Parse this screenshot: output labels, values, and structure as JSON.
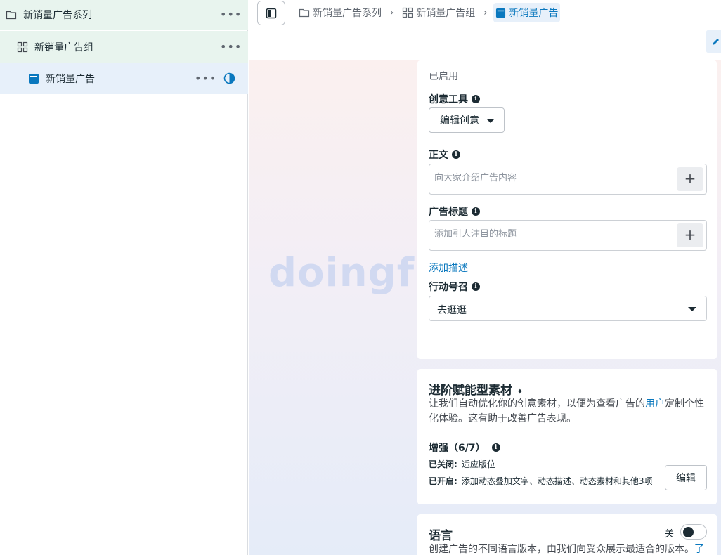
{
  "sidebar": {
    "items": [
      {
        "label": "新销量广告系列",
        "icon": "folder-icon"
      },
      {
        "label": "新销量广告组",
        "icon": "grid-icon"
      },
      {
        "label": "新销量广告",
        "icon": "ad-icon"
      }
    ],
    "more": "•••"
  },
  "breadcrumb": {
    "items": [
      {
        "label": "新销量广告系列",
        "icon": "folder-icon"
      },
      {
        "label": "新销量广告组",
        "icon": "grid-icon"
      },
      {
        "label": "新销量广告",
        "icon": "ad-icon"
      }
    ],
    "separator": "›"
  },
  "watermark": "doingfi",
  "creative": {
    "status_value": "已启用",
    "creative_tools_label": "创意工具",
    "edit_creative_button": "编辑创意",
    "primary_text_label": "正文",
    "primary_text_placeholder": "向大家介绍广告内容",
    "headline_label": "广告标题",
    "headline_placeholder": "添加引人注目的标题",
    "add_description_link": "添加描述",
    "cta_label": "行动号召",
    "cta_value": "去逛逛",
    "plus": "+"
  },
  "advantage": {
    "title": "进阶赋能型素材",
    "sparkle": "✦",
    "desc_before": "让我们自动优化你的创意素材，以便为查看广告的",
    "desc_link": "用户",
    "desc_after": "定制个性化体验。这有助于改善广告表现。",
    "enhance_label": "增强（6/7）",
    "off_key": "已关闭:",
    "off_value": "适应版位",
    "on_key": "已开启:",
    "on_value": "添加动态叠加文字、动态描述、动态素材和其他3项",
    "edit_button": "编辑"
  },
  "language": {
    "title": "语言",
    "toggle_label": "关",
    "desc": "创建广告的不同语言版本，由我们向受众展示最适合的版本。",
    "desc_link": "了"
  },
  "colors": {
    "accent": "#0a78be",
    "sidebar_green": "#e8f4ee",
    "sidebar_blue": "#e7f0fa"
  }
}
